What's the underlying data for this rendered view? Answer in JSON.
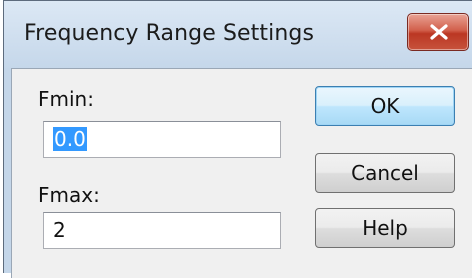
{
  "dialog": {
    "title": "Frequency Range Settings",
    "close_icon": "close-x-icon"
  },
  "fields": {
    "fmin_label": "Fmin:",
    "fmin_value": "0.0",
    "fmax_label": "Fmax:",
    "fmax_value": "2"
  },
  "buttons": {
    "ok": "OK",
    "cancel": "Cancel",
    "help": "Help"
  }
}
